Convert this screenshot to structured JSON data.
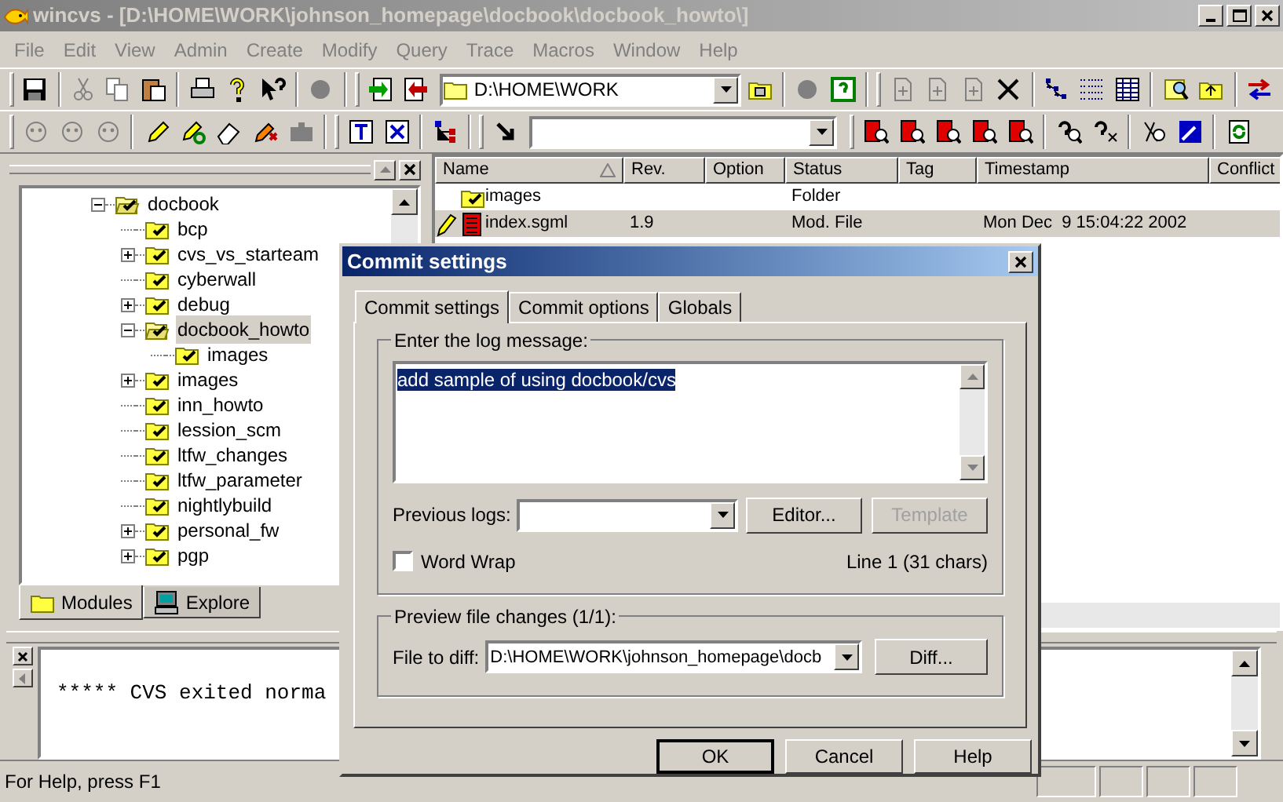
{
  "window": {
    "title": "wincvs - [D:\\HOME\\WORK\\johnson_homepage\\docbook\\docbook_howto\\]"
  },
  "menu": [
    "File",
    "Edit",
    "View",
    "Admin",
    "Create",
    "Modify",
    "Query",
    "Trace",
    "Macros",
    "Window",
    "Help"
  ],
  "toolbar": {
    "location": "D:\\HOME\\WORK"
  },
  "tree": {
    "items": [
      {
        "label": "docbook",
        "has_children": true,
        "expanded": true,
        "selected": false,
        "children": [
          {
            "label": "bcp",
            "has_children": false,
            "selected": false
          },
          {
            "label": "cvs_vs_starteam",
            "has_children": true,
            "expanded": false,
            "selected": false
          },
          {
            "label": "cyberwall",
            "has_children": false,
            "selected": false
          },
          {
            "label": "debug",
            "has_children": true,
            "expanded": false,
            "selected": false
          },
          {
            "label": "docbook_howto",
            "has_children": true,
            "expanded": true,
            "selected": true,
            "children": [
              {
                "label": "images",
                "has_children": false,
                "selected": false
              }
            ]
          },
          {
            "label": "images",
            "has_children": true,
            "expanded": false,
            "selected": false
          },
          {
            "label": "inn_howto",
            "has_children": false,
            "selected": false
          },
          {
            "label": "lession_scm",
            "has_children": false,
            "selected": false
          },
          {
            "label": "ltfw_changes",
            "has_children": false,
            "selected": false
          },
          {
            "label": "ltfw_parameter",
            "has_children": false,
            "selected": false
          },
          {
            "label": "nightlybuild",
            "has_children": false,
            "selected": false
          },
          {
            "label": "personal_fw",
            "has_children": true,
            "expanded": false,
            "selected": false
          },
          {
            "label": "pgp",
            "has_children": true,
            "expanded": false,
            "selected": false
          }
        ]
      }
    ]
  },
  "pane_tabs": [
    {
      "label": "Modules",
      "selected": true
    },
    {
      "label": "Explore",
      "selected": false
    }
  ],
  "file_list": {
    "columns": [
      {
        "label": "Name",
        "sorted": true
      },
      {
        "label": "Rev.",
        "sorted": false
      },
      {
        "label": "Option",
        "sorted": false
      },
      {
        "label": "Status",
        "sorted": false
      },
      {
        "label": "Tag",
        "sorted": false
      },
      {
        "label": "Timestamp",
        "sorted": false
      },
      {
        "label": "Conflict",
        "sorted": false
      }
    ],
    "rows": [
      {
        "kind": "folder",
        "name": "images",
        "status": "Folder",
        "selected": false,
        "modified": false
      },
      {
        "kind": "file",
        "name": "index.sgml",
        "rev": "1.9",
        "status": "Mod. File",
        "timestamp": "Mon Dec  9 15:04:22 2002",
        "selected": true,
        "modified": true
      }
    ]
  },
  "output": {
    "text": "***** CVS exited norma"
  },
  "status_bar": {
    "text": "For Help, press F1"
  },
  "dialog": {
    "title": "Commit settings",
    "tabs": [
      {
        "label": "Commit settings",
        "selected": true
      },
      {
        "label": "Commit options",
        "selected": false
      },
      {
        "label": "Globals",
        "selected": false
      }
    ],
    "log_group": "Enter the log message:",
    "log_message": "add sample of using docbook/cvs",
    "log_selected": true,
    "previous_logs_label": "Previous logs:",
    "editor_button": {
      "label": "Editor...",
      "disabled": false
    },
    "template_button": {
      "label": "Template",
      "disabled": true
    },
    "word_wrap": {
      "label": "Word Wrap",
      "checked": false
    },
    "line_info": "Line 1 (31 chars)",
    "preview_group": "Preview file changes (1/1):",
    "file_to_diff_label": "File to diff:",
    "file_to_diff": "D:\\HOME\\WORK\\johnson_homepage\\docb",
    "diff_button": "Diff...",
    "buttons": [
      {
        "label": "OK",
        "default": true
      },
      {
        "label": "Cancel",
        "default": false
      },
      {
        "label": "Help",
        "default": false
      }
    ]
  }
}
